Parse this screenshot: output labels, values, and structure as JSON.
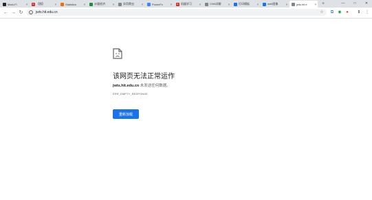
{
  "tabs": [
    {
      "title": "Mark-Fi",
      "fav": "github-icon",
      "fav_color": "#24292e",
      "fav_text": ""
    },
    {
      "title": "【图】",
      "fav": "csdn-icon",
      "fav_color": "#c9302c",
      "fav_text": "C"
    },
    {
      "title": "Statistics",
      "fav": "statistics-icon",
      "fav_color": "#e8710a",
      "fav_text": ""
    },
    {
      "title": "计量经济",
      "fav": "sogou-icon",
      "fav_color": "#1e8e3e",
      "fav_text": ""
    },
    {
      "title": "实用爬虫",
      "fav": "edit-icon",
      "fav_color": "#80868b",
      "fav_text": ""
    },
    {
      "title": "PowerFx",
      "fav": "powerfx-icon",
      "fav_color": "#4285f4",
      "fav_text": ""
    },
    {
      "title": "机器学习",
      "fav": "csdn-icon",
      "fav_color": "#c9302c",
      "fav_text": "C"
    },
    {
      "title": "CNN详解",
      "fav": "doc-icon",
      "fav_color": "#80868b",
      "fav_text": ""
    },
    {
      "title": "打印模板",
      "fav": "bracket-icon",
      "fav_color": "#1a73e8",
      "fav_text": ""
    },
    {
      "title": "web图像",
      "fav": "star-icon",
      "fav_color": "#1a73e8",
      "fav_text": ""
    },
    {
      "title": "jwts.hit.e",
      "fav": "page-icon",
      "fav_color": "#80868b",
      "fav_text": "",
      "active": true
    }
  ],
  "toolbar": {
    "url": "jwts.hit.edu.cn",
    "extension_badge": "5"
  },
  "error": {
    "title": "该网页无法正常运作",
    "host": "jwts.hit.edu.cn",
    "desc_suffix": " 未发送任何数据。",
    "code": "ERR_EMPTY_RESPONSE",
    "reload_label": "重新加载"
  },
  "colors": {
    "accent": "#1a73e8",
    "tabstrip": "#dee1e6"
  }
}
